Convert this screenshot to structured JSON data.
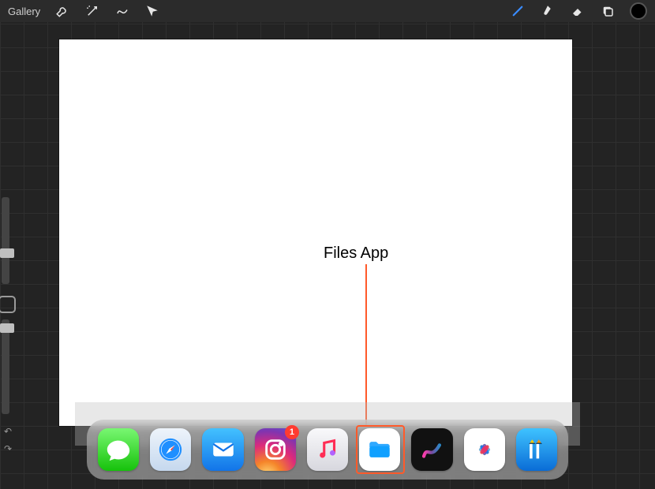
{
  "topbar": {
    "gallery_label": "Gallery",
    "left_tools": [
      "wrench",
      "wand",
      "s-curve",
      "arrow"
    ],
    "right_tools": [
      "brush",
      "smudge",
      "eraser",
      "layers",
      "color"
    ]
  },
  "annotation": {
    "label": "Files App"
  },
  "dock": {
    "apps": [
      {
        "name": "Messages",
        "icon": "messages",
        "badge": null
      },
      {
        "name": "Safari",
        "icon": "safari",
        "badge": null
      },
      {
        "name": "Mail",
        "icon": "mail",
        "badge": null
      },
      {
        "name": "Instagram",
        "icon": "instagram",
        "badge": "1"
      },
      {
        "name": "Music",
        "icon": "music",
        "badge": null
      },
      {
        "name": "Files",
        "icon": "files",
        "badge": null,
        "highlighted": true
      },
      {
        "name": "Procreate",
        "icon": "procreate",
        "badge": null
      },
      {
        "name": "Photos",
        "icon": "photos",
        "badge": null
      },
      {
        "name": "Affinity",
        "icon": "affinity",
        "badge": null
      }
    ]
  },
  "canvas": {
    "blank": true
  },
  "color_swatch": "#000000"
}
